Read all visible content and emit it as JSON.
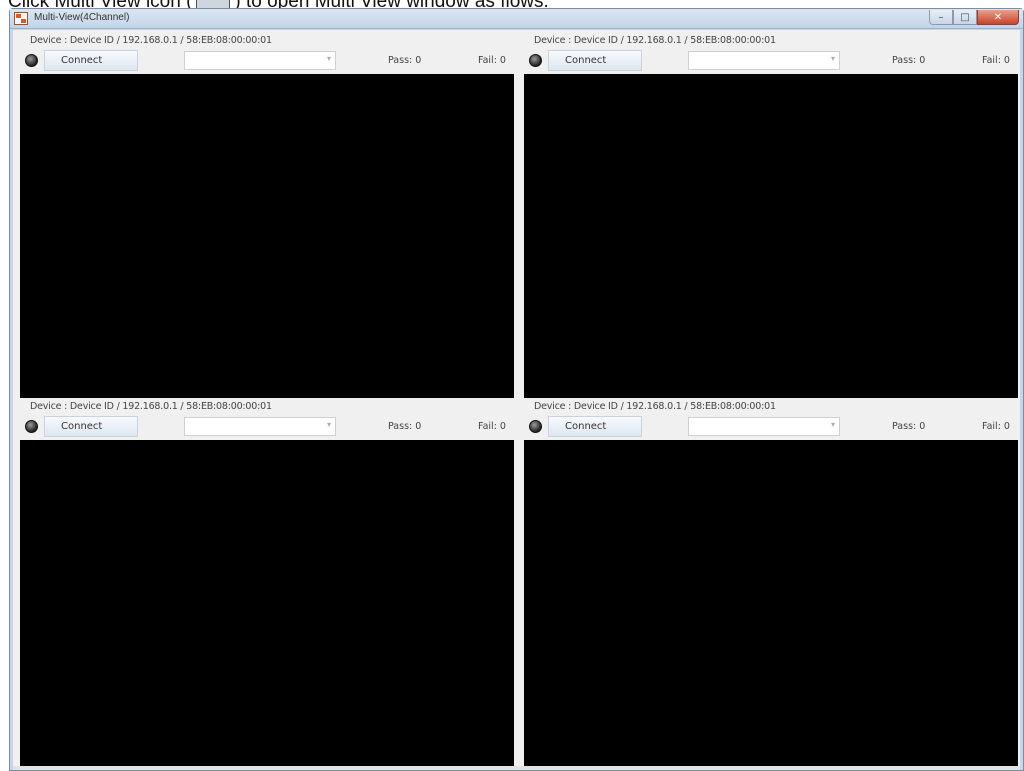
{
  "caption": {
    "before": "Click Multi View icon (",
    "after": ") to open Multi View window as flows."
  },
  "window": {
    "title": "Multi-View(4Channel)",
    "buttons": {
      "minimize": "–",
      "maximize": "□",
      "close": "✕"
    }
  },
  "panels": [
    {
      "device": "Device : Device ID / 192.168.0.1 / 58:EB:08:00:00:01",
      "connect": "Connect",
      "pass": "Pass: 0",
      "fail": "Fail: 0"
    },
    {
      "device": "Device : Device ID / 192.168.0.1 / 58:EB:08:00:00:01",
      "connect": "Connect",
      "pass": "Pass: 0",
      "fail": "Fail: 0"
    },
    {
      "device": "Device : Device ID / 192.168.0.1 / 58:EB:08:00:00:01",
      "connect": "Connect",
      "pass": "Pass: 0",
      "fail": "Fail: 0"
    },
    {
      "device": "Device : Device ID / 192.168.0.1 / 58:EB:08:00:00:01",
      "connect": "Connect",
      "pass": "Pass: 0",
      "fail": "Fail: 0"
    }
  ],
  "icons": {
    "app": "multi-view-app-icon",
    "status": "connection-status-led-icon",
    "dropdown": "chevron-down-icon"
  },
  "colors": {
    "video_background": "#000000",
    "window_frame": "#c6d6e8",
    "close_button": "#c8432b"
  }
}
